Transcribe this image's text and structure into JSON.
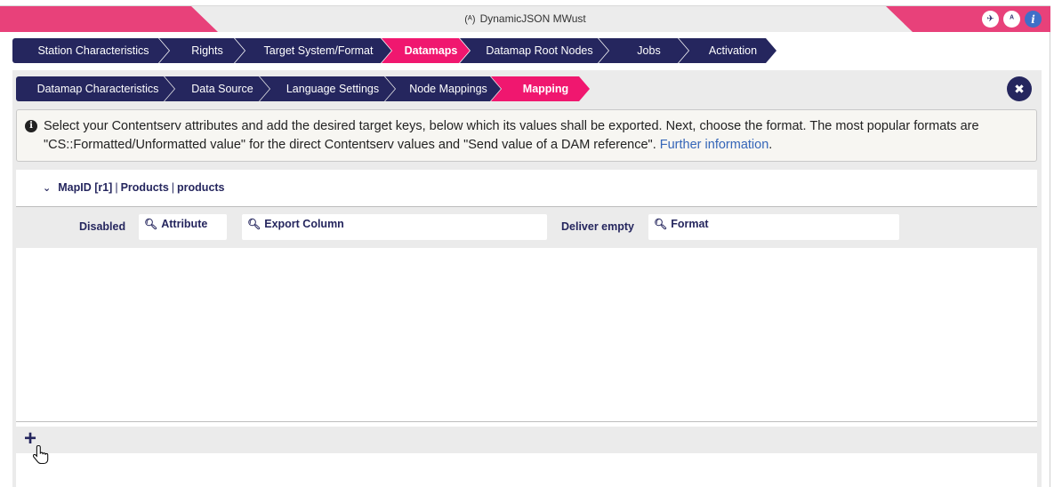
{
  "titlebar": {
    "title": "DynamicJSON MWust",
    "antenna_glyph": "(A)",
    "icons": [
      "plane-icon",
      "antenna-icon",
      "info-icon"
    ],
    "accent": "#e8417a"
  },
  "nav_main": [
    {
      "label": "Station Characteristics",
      "active": false
    },
    {
      "label": "Rights",
      "active": false
    },
    {
      "label": "Target System/Format",
      "active": false
    },
    {
      "label": "Datamaps",
      "active": true
    },
    {
      "label": "Datamap Root Nodes",
      "active": false
    },
    {
      "label": "Jobs",
      "active": false
    },
    {
      "label": "Activation",
      "active": false
    }
  ],
  "nav_sub": [
    {
      "label": "Datamap Characteristics",
      "active": false
    },
    {
      "label": "Data Source",
      "active": false
    },
    {
      "label": "Language Settings",
      "active": false
    },
    {
      "label": "Node Mappings",
      "active": false
    },
    {
      "label": "Mapping",
      "active": true
    }
  ],
  "info": {
    "text": "Select your Contentserv attributes and add the desired target keys, below which its values shall be exported. Next, choose the format. The most popular formats are \"CS::Formatted/Unformatted value\" for the direct Contentserv values and \"Send value of a DAM reference\". ",
    "link": "Further information",
    "tail": "."
  },
  "map": {
    "id": "MapID [r1]",
    "part2": "Products",
    "part3": "products",
    "sep": "|"
  },
  "filters": {
    "disabled_label": "Disabled",
    "attribute": "Attribute",
    "export_column": "Export Column",
    "deliver_empty_label": "Deliver empty",
    "format": "Format"
  },
  "actions": {
    "add": "+"
  },
  "colors": {
    "nav_dark": "#25265e",
    "nav_active": "#f0176f",
    "link": "#3566b8"
  }
}
